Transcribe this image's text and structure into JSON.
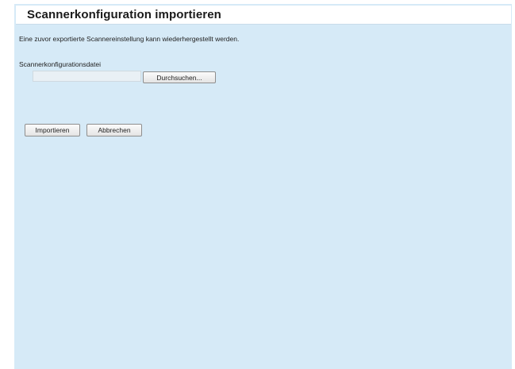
{
  "header": {
    "title": "Scannerkonfiguration importieren"
  },
  "main": {
    "description": "Eine zuvor exportierte Scannereinstellung kann wiederhergestellt werden.",
    "file_field": {
      "label": "Scannerkonfigurationsdatei",
      "value": "",
      "browse_label": "Durchsuchen..."
    },
    "actions": {
      "import_label": "Importieren",
      "cancel_label": "Abbrechen"
    }
  },
  "colors": {
    "panel_background": "#d6eaf7",
    "header_background": "#ffffff"
  }
}
